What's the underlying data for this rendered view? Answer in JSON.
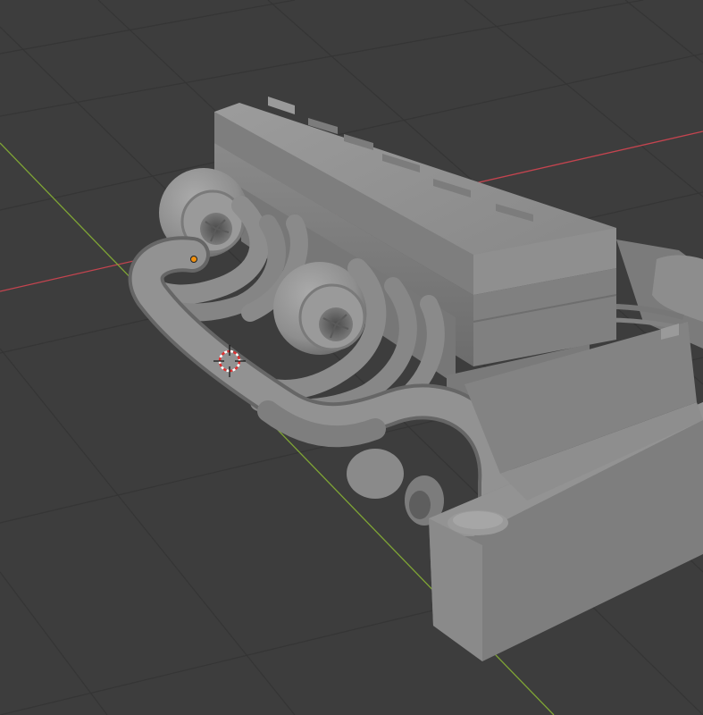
{
  "viewport": {
    "view": "3d-viewport",
    "shading": "solid",
    "background_color": "#3d3d3d",
    "grid_color": "#353535",
    "x_axis_color": "#c4444f",
    "y_axis_color": "#7fa535",
    "origin_color": "#f0900f",
    "cursor_colors": [
      "#e03030",
      "#ffffff"
    ]
  },
  "scene": {
    "object": "engine",
    "object_color": "#8c8c8c",
    "parts": [
      "cylinder-head-cover",
      "engine-block",
      "turbocharger-front",
      "turbocharger-rear",
      "exhaust-manifold",
      "intake-pipe",
      "intercooler",
      "downpipe"
    ]
  }
}
